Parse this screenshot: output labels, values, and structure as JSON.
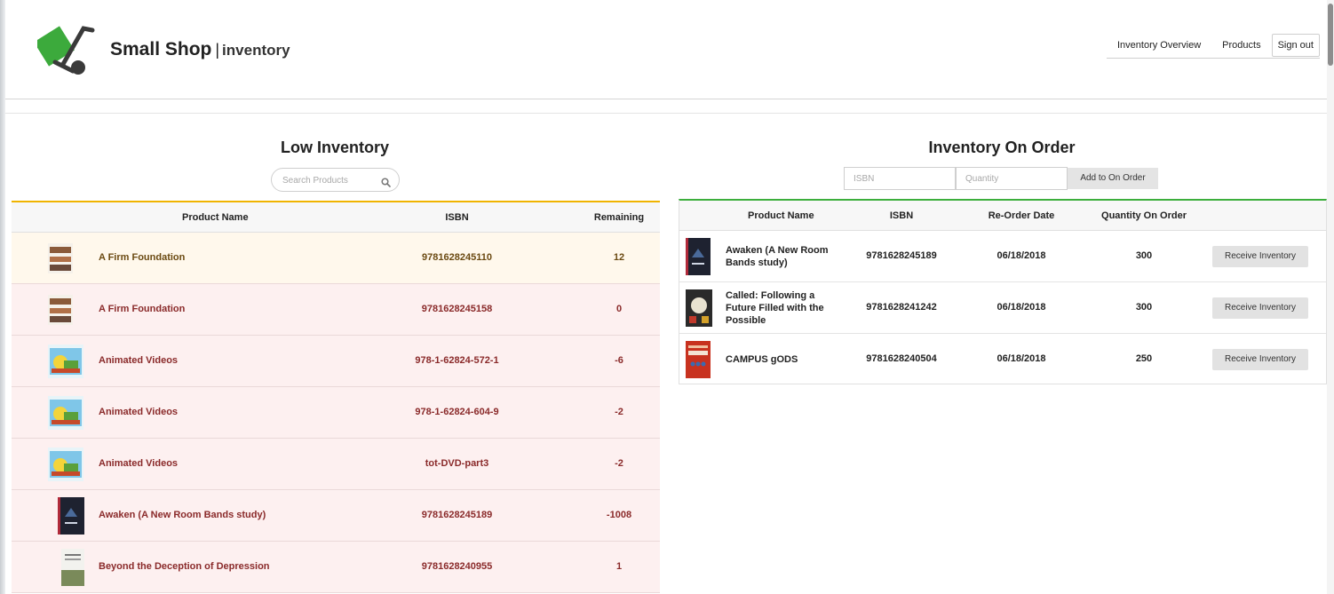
{
  "brand": {
    "name": "Small Shop",
    "separator": "|",
    "subtitle": "inventory"
  },
  "nav": {
    "overview": "Inventory Overview",
    "products": "Products",
    "signout": "Sign out"
  },
  "low_inventory": {
    "title": "Low Inventory",
    "search_placeholder": "Search Products",
    "columns": {
      "name": "Product Name",
      "isbn": "ISBN",
      "remaining": "Remaining"
    },
    "rows": [
      {
        "name": "A Firm Foundation",
        "isbn": "9781628245110",
        "remaining": "12"
      },
      {
        "name": "A Firm Foundation",
        "isbn": "9781628245158",
        "remaining": "0"
      },
      {
        "name": "Animated Videos",
        "isbn": "978-1-62824-572-1",
        "remaining": "-6"
      },
      {
        "name": "Animated Videos",
        "isbn": "978-1-62824-604-9",
        "remaining": "-2"
      },
      {
        "name": "Animated Videos",
        "isbn": "tot-DVD-part3",
        "remaining": "-2"
      },
      {
        "name": "Awaken (A New Room Bands study)",
        "isbn": "9781628245189",
        "remaining": "-1008"
      },
      {
        "name": "Beyond the Deception of Depression",
        "isbn": "9781628240955",
        "remaining": "1"
      }
    ]
  },
  "on_order": {
    "title": "Inventory On Order",
    "isbn_placeholder": "ISBN",
    "quantity_placeholder": "Quantity",
    "add_label": "Add to On Order",
    "columns": {
      "name": "Product Name",
      "isbn": "ISBN",
      "date": "Re-Order Date",
      "quantity": "Quantity On Order"
    },
    "receive_label": "Receive Inventory",
    "rows": [
      {
        "name_line1": "Awaken (A New Room",
        "name_line2": "Bands study)",
        "name_line3": "",
        "isbn": "9781628245189",
        "date": "06/18/2018",
        "quantity": "300"
      },
      {
        "name_line1": "Called: Following a",
        "name_line2": "Future Filled with the",
        "name_line3": "Possible",
        "isbn": "9781628241242",
        "date": "06/18/2018",
        "quantity": "300"
      },
      {
        "name_line1": "CAMPUS gODS",
        "name_line2": "",
        "name_line3": "",
        "isbn": "9781628240504",
        "date": "06/18/2018",
        "quantity": "250"
      }
    ]
  },
  "colors": {
    "low_accent": "#f0b400",
    "order_accent": "#3cae3c",
    "danger_row": "#fdf0f0",
    "warn_row": "#fff8ec",
    "danger_text": "#8a2a2a",
    "logo_green": "#3caa3c"
  }
}
